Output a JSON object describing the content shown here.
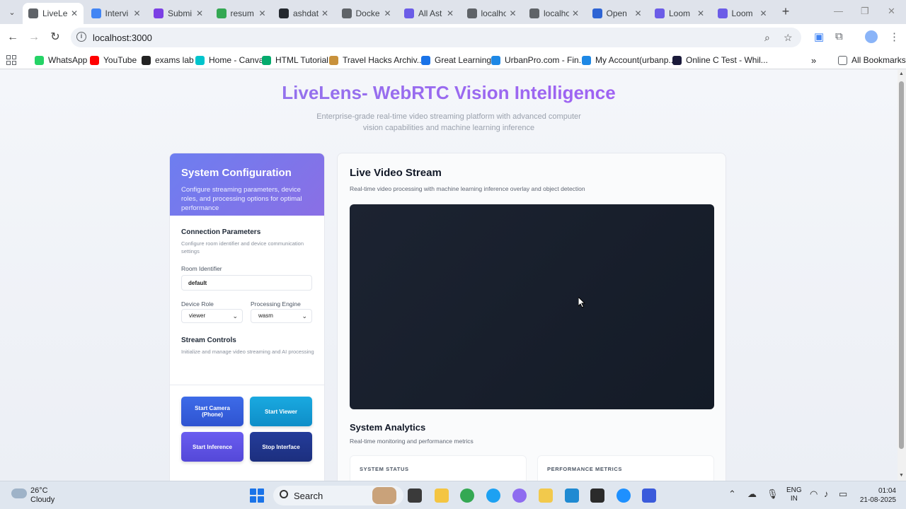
{
  "browser": {
    "tabs": [
      {
        "label": "LiveLe",
        "active": true,
        "color": "#5f6368"
      },
      {
        "label": "Intervi",
        "active": false,
        "color": "#4285f4"
      },
      {
        "label": "Submi",
        "active": false,
        "color": "#7b3fe4"
      },
      {
        "label": "resum",
        "active": false,
        "color": "#34a853"
      },
      {
        "label": "ashdat",
        "active": false,
        "color": "#24292f"
      },
      {
        "label": "Docke",
        "active": false,
        "color": "#5f6368"
      },
      {
        "label": "All Ast",
        "active": false,
        "color": "#6b5ce7"
      },
      {
        "label": "localho",
        "active": false,
        "color": "#5f6368"
      },
      {
        "label": "localho",
        "active": false,
        "color": "#5f6368"
      },
      {
        "label": "Open",
        "active": false,
        "color": "#2e64d4"
      },
      {
        "label": "Loom",
        "active": false,
        "color": "#6b5ce7"
      },
      {
        "label": "Loom",
        "active": false,
        "color": "#6b5ce7"
      }
    ],
    "url": "localhost:3000",
    "bookmarks": [
      {
        "label": "WhatsApp",
        "color": "#25d366"
      },
      {
        "label": "YouTube",
        "color": "#ff0000"
      },
      {
        "label": "exams lab",
        "color": "#222222"
      },
      {
        "label": "Home - Canva",
        "color": "#00c4cc"
      },
      {
        "label": "HTML Tutorial",
        "color": "#04aa6d"
      },
      {
        "label": "Travel Hacks Archiv...",
        "color": "#c8913b"
      },
      {
        "label": "Great Learning",
        "color": "#1a73e8"
      },
      {
        "label": "UrbanPro.com - Fin...",
        "color": "#1e88e5"
      },
      {
        "label": "My Account(urbanp...",
        "color": "#1e88e5"
      },
      {
        "label": "Online C Test - Whil...",
        "color": "#1a1a3a"
      }
    ],
    "all_bookmarks_label": "All Bookmarks"
  },
  "hero": {
    "title": "LiveLens- WebRTC Vision Intelligence",
    "subtitle": "Enterprise-grade real-time video streaming platform with advanced computer vision capabilities and machine learning inference"
  },
  "config": {
    "title": "System Configuration",
    "description": "Configure streaming parameters, device roles, and processing options for optimal performance",
    "connection": {
      "title": "Connection Parameters",
      "description": "Configure room identifier and device communication settings",
      "room_label": "Room Identifier",
      "room_value": "default",
      "device_role_label": "Device Role",
      "device_role_value": "viewer",
      "engine_label": "Processing Engine",
      "engine_value": "wasm"
    },
    "stream": {
      "title": "Stream Controls",
      "description": "Initialize and manage video streaming and AI processing"
    },
    "buttons": {
      "start_camera": "Start Camera (Phone)",
      "start_viewer": "Start Viewer",
      "start_inference": "Start Inference",
      "stop_interface": "Stop Interface"
    }
  },
  "video": {
    "title": "Live Video Stream",
    "description": "Real-time video processing with machine learning inference overlay and object detection"
  },
  "analytics": {
    "title": "System Analytics",
    "description": "Real-time monitoring and performance metrics",
    "status_label": "SYSTEM STATUS",
    "metrics_label": "PERFORMANCE METRICS"
  },
  "taskbar": {
    "temperature": "26°C",
    "weather": "Cloudy",
    "search_label": "Search",
    "lang_line1": "ENG",
    "lang_line2": "IN",
    "time": "01:04",
    "date": "21-08-2025"
  }
}
